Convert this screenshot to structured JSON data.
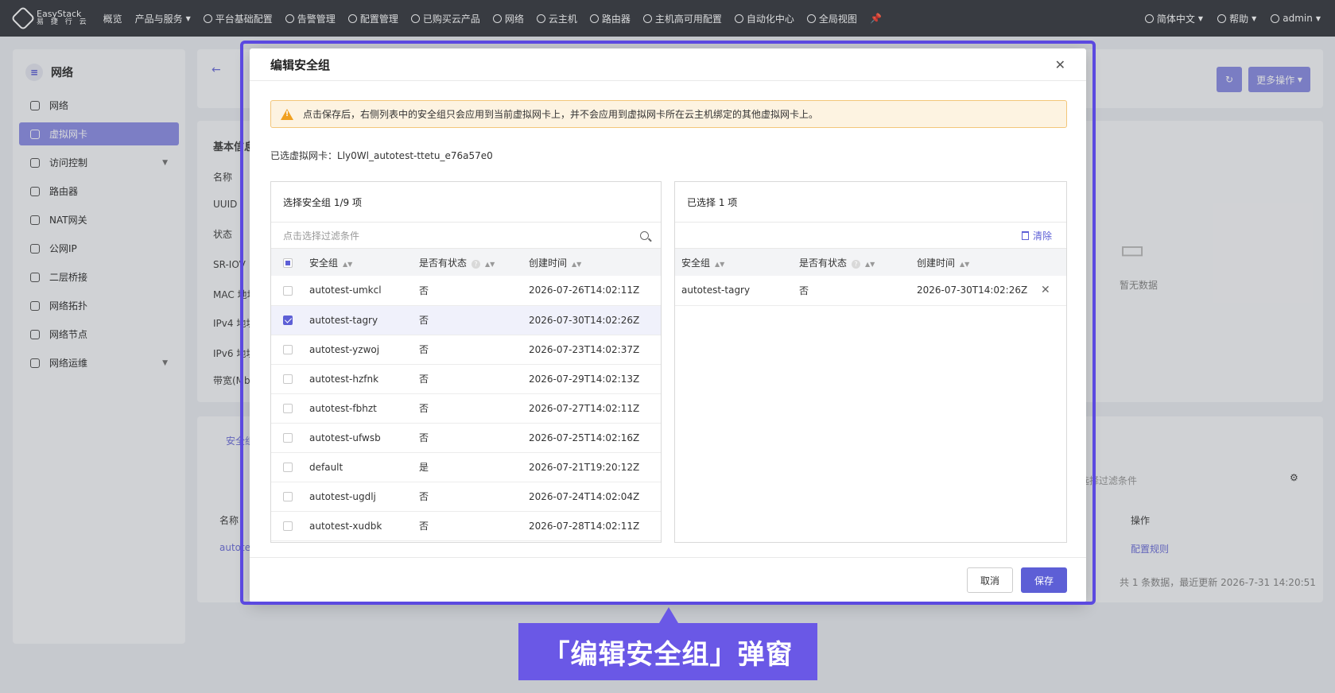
{
  "topbar": {
    "logo_name": "EasyStack",
    "logo_sub": "易 捷 行 云",
    "nav_items": [
      "概览",
      "产品与服务",
      "平台基础配置",
      "告警管理",
      "配置管理",
      "已购买云产品",
      "网络",
      "云主机",
      "路由器",
      "主机高可用配置",
      "自动化中心",
      "全局视图"
    ],
    "language": "简体中文",
    "help": "帮助",
    "user": "admin"
  },
  "sidebar": {
    "title": "网络",
    "items": [
      {
        "label": "网络"
      },
      {
        "label": "虚拟网卡"
      },
      {
        "label": "访问控制"
      },
      {
        "label": "路由器"
      },
      {
        "label": "NAT网关"
      },
      {
        "label": "公网IP"
      },
      {
        "label": "二层桥接"
      },
      {
        "label": "网络拓扑"
      },
      {
        "label": "网络节点"
      },
      {
        "label": "网络运维"
      }
    ]
  },
  "background": {
    "more_actions": "更多操作",
    "basic_info": "基本信息",
    "fields": [
      "名称",
      "UUID",
      "状态",
      "SR-IOV",
      "MAC 地址",
      "IPv4 地址",
      "IPv6 地址",
      "带宽(Mbps)"
    ],
    "empty": "暂无数据",
    "tab_security": "安全组",
    "filter_placeholder": "选择过滤条件",
    "col_name": "名称",
    "col_action": "操作",
    "row_name": "autotest",
    "row_action": "配置规则",
    "footer": "共 1 条数据，最近更新  2026-7-31 14:20:51"
  },
  "modal": {
    "title": "编辑安全组",
    "alert": "点击保存后，右侧列表中的安全组只会应用到当前虚拟网卡上，并不会应用到虚拟网卡所在云主机绑定的其他虚拟网卡上。",
    "selected_nic_label": "已选虚拟网卡：",
    "selected_nic_value": "Lly0Wl_autotest-ttetu_e76a57e0",
    "left_title": "选择安全组 1/9 项",
    "search_placeholder": "点击选择过滤条件",
    "columns": {
      "group": "安全组",
      "stateful": "是否有状态",
      "created": "创建时间"
    },
    "rows": [
      {
        "name": "autotest-umkcl",
        "stateful": "否",
        "created": "2026-07-26T14:02:11Z",
        "checked": false
      },
      {
        "name": "autotest-tagry",
        "stateful": "否",
        "created": "2026-07-30T14:02:26Z",
        "checked": true
      },
      {
        "name": "autotest-yzwoj",
        "stateful": "否",
        "created": "2026-07-23T14:02:37Z",
        "checked": false
      },
      {
        "name": "autotest-hzfnk",
        "stateful": "否",
        "created": "2026-07-29T14:02:13Z",
        "checked": false
      },
      {
        "name": "autotest-fbhzt",
        "stateful": "否",
        "created": "2026-07-27T14:02:11Z",
        "checked": false
      },
      {
        "name": "autotest-ufwsb",
        "stateful": "否",
        "created": "2026-07-25T14:02:16Z",
        "checked": false
      },
      {
        "name": "default",
        "stateful": "是",
        "created": "2026-07-21T19:20:12Z",
        "checked": false
      },
      {
        "name": "autotest-ugdlj",
        "stateful": "否",
        "created": "2026-07-24T14:02:04Z",
        "checked": false
      },
      {
        "name": "autotest-xudbk",
        "stateful": "否",
        "created": "2026-07-28T14:02:11Z",
        "checked": false
      }
    ],
    "right_title": "已选择 1 项",
    "clear_label": "清除",
    "selected_rows": [
      {
        "name": "autotest-tagry",
        "stateful": "否",
        "created": "2026-07-30T14:02:26Z"
      }
    ],
    "cancel_label": "取消",
    "save_label": "保存"
  },
  "annotation": {
    "callout": "「编辑安全组」弹窗"
  },
  "colors": {
    "accent": "#5d5fd6",
    "highlight": "#5b49e0",
    "callout_bg": "#6a58e6"
  }
}
